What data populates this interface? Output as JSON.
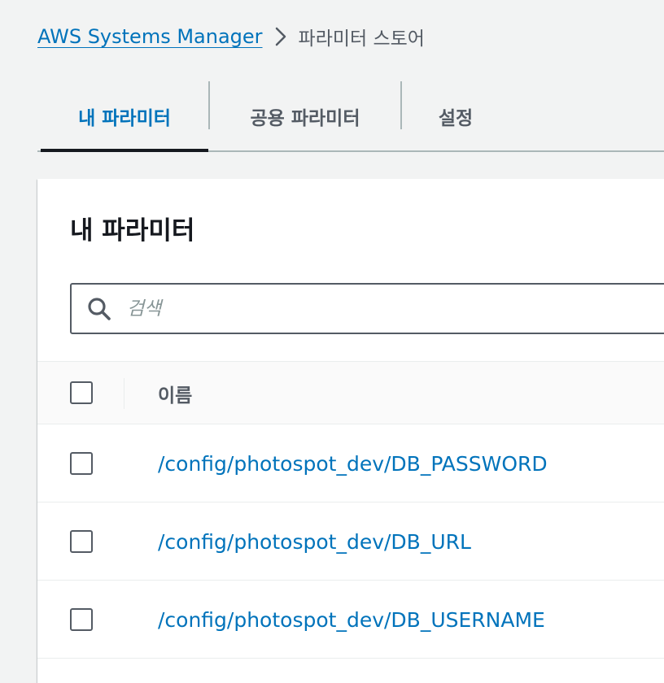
{
  "breadcrumb": {
    "service": "AWS Systems Manager",
    "current": "파라미터 스토어"
  },
  "tabs": [
    {
      "label": "내 파라미터",
      "active": true
    },
    {
      "label": "공용 파라미터",
      "active": false
    },
    {
      "label": "설정",
      "active": false
    }
  ],
  "panel": {
    "title": "내 파라미터",
    "search": {
      "placeholder": "검색",
      "value": ""
    },
    "table": {
      "columns": [
        "이름"
      ],
      "rows": [
        {
          "name": "/config/photospot_dev/DB_PASSWORD",
          "checked": false
        },
        {
          "name": "/config/photospot_dev/DB_URL",
          "checked": false
        },
        {
          "name": "/config/photospot_dev/DB_USERNAME",
          "checked": false
        }
      ]
    }
  },
  "colors": {
    "link": "#0073bb",
    "text": "#16191f",
    "muted": "#545b64",
    "background": "#f2f3f3"
  },
  "icons": {
    "breadcrumb_separator": "chevron-right-icon",
    "search": "search-icon"
  }
}
